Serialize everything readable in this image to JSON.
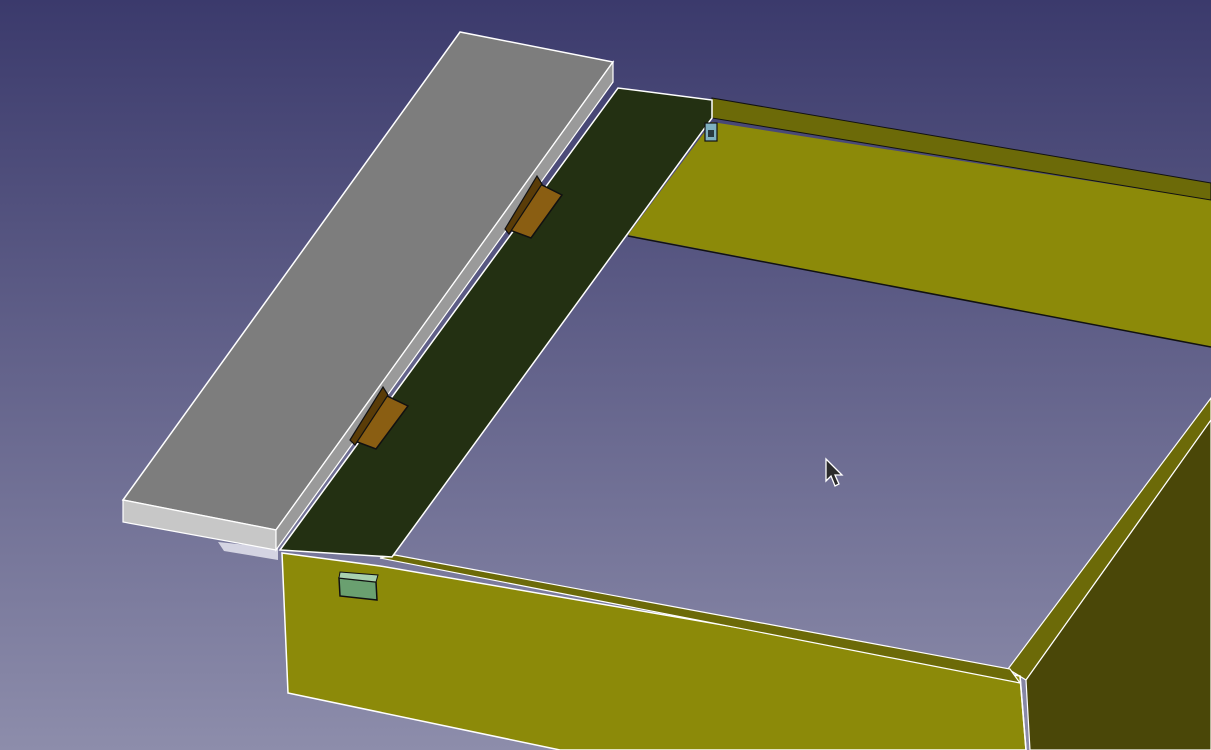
{
  "app": {
    "view": "3d-viewport"
  },
  "colors": {
    "background_top": "#3b3a6c",
    "background_bottom": "#8d8dab",
    "board_top": "#7d7d7d",
    "board_side_front": "#c7c7c7",
    "board_side_right": "#9a9a9a",
    "dark_strip": "#233012",
    "olive_wall": "#8c8a09",
    "olive_wall_top": "#6c6a08",
    "olive_wall_shade": "#4a4708",
    "bracket": "#8a5e12",
    "green_tab": "#6aa070",
    "edge_highlight": "#ffffff",
    "edge_dark": "#111111"
  },
  "scene": {
    "objects": [
      {
        "name": "grey-board",
        "color_key": "board_top"
      },
      {
        "name": "dark-strip",
        "color_key": "dark_strip"
      },
      {
        "name": "olive-frame",
        "color_key": "olive_wall"
      },
      {
        "name": "angle-bracket",
        "color_key": "bracket",
        "count": 2
      },
      {
        "name": "green-tab",
        "color_key": "green_tab"
      },
      {
        "name": "small-hinge",
        "color_key": "green_tab"
      }
    ]
  },
  "cursor": {
    "icon": "arrow-pointer-icon"
  }
}
